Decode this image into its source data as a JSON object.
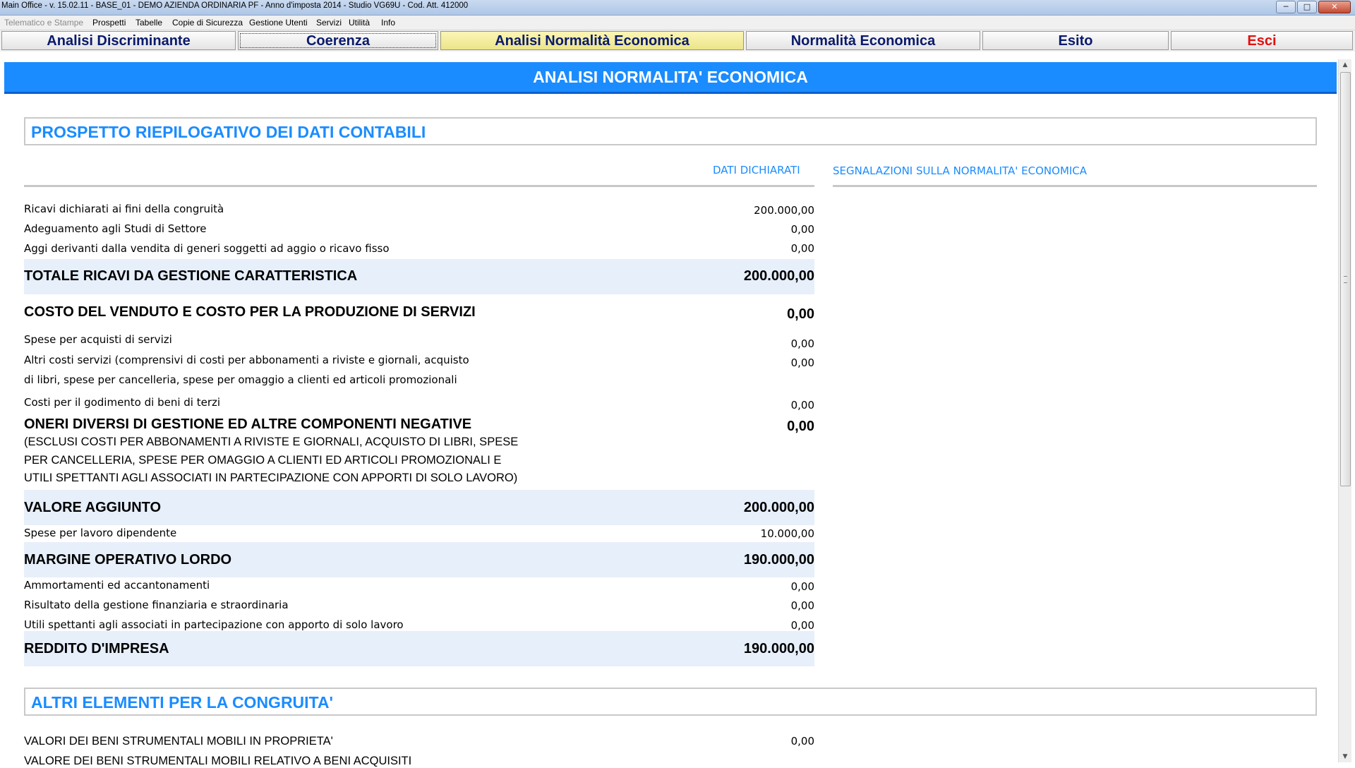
{
  "window": {
    "title": "Main Office - v. 15.02.11 - BASE_01 - DEMO AZIENDA ORDINARIA PF - Anno d'imposta 2014 - Studio VG69U - Cod. Att. 412000",
    "min": "─",
    "max": "□",
    "close": "✕"
  },
  "menu": {
    "telematico": "Telematico e Stampe",
    "prospetti": "Prospetti",
    "tabelle": "Tabelle",
    "copie": "Copie di Sicurezza",
    "utenti": "Gestione Utenti",
    "servizi": "Servizi",
    "utilita": "Utilità",
    "info": "Info"
  },
  "tabs": {
    "discriminante": "Analisi Discriminante",
    "coerenza": "Coerenza",
    "normalita_analisi": "Analisi Normalità Economica",
    "normalita": "Normalità Economica",
    "esito": "Esito",
    "esci": "Esci"
  },
  "page": {
    "banner": "ANALISI NORMALITA' ECONOMICA",
    "section1": "PROSPETTO RIEPILOGATIVO DEI DATI CONTABILI",
    "col_dati": "DATI DICHIARATI",
    "col_segnalazioni": "SEGNALAZIONI SULLA NORMALITA' ECONOMICA",
    "section2": "ALTRI ELEMENTI PER LA CONGRUITA'"
  },
  "rows": {
    "ricavi_label": "Ricavi dichiarati ai fini della congruità",
    "ricavi_value": "200.000,00",
    "adeguamento_label": "Adeguamento agli Studi di Settore",
    "adeguamento_value": "0,00",
    "aggi_label": "Aggi derivanti dalla vendita di generi soggetti ad aggio o ricavo fisso",
    "aggi_value": "0,00",
    "totale_label": "TOTALE RICAVI DA GESTIONE CARATTERISTICA",
    "totale_value": "200.000,00",
    "costo_label": "COSTO DEL VENDUTO E COSTO PER LA PRODUZIONE DI SERVIZI",
    "costo_value": "0,00",
    "spese_servizi_label": "Spese per acquisti di servizi",
    "spese_servizi_value": "0,00",
    "altri_costi_label1": "Altri costi servizi (comprensivi di costi per abbonamenti a riviste e giornali, acquisto",
    "altri_costi_label2": "di libri, spese per cancelleria, spese per omaggio a clienti ed articoli promozionali",
    "altri_costi_value": "0,00",
    "godimento_label": "Costi per il godimento di beni di terzi",
    "godimento_value": "0,00",
    "oneri_label": "ONERI DIVERSI DI GESTIONE ED ALTRE COMPONENTI NEGATIVE",
    "oneri_value": "0,00",
    "oneri_note1": "(ESCLUSI COSTI PER ABBONAMENTI A RIVISTE E GIORNALI, ACQUISTO DI LIBRI, SPESE",
    "oneri_note2": "PER CANCELLERIA, SPESE PER OMAGGIO A CLIENTI ED ARTICOLI PROMOZIONALI E",
    "oneri_note3": "UTILI SPETTANTI AGLI ASSOCIATI IN PARTECIPAZIONE CON APPORTI DI SOLO LAVORO)",
    "valore_aggiunto_label": "VALORE AGGIUNTO",
    "valore_aggiunto_value": "200.000,00",
    "lavoro_label": "Spese per lavoro dipendente",
    "lavoro_value": "10.000,00",
    "mol_label": "MARGINE OPERATIVO LORDO",
    "mol_value": "190.000,00",
    "ammortamenti_label": "Ammortamenti ed accantonamenti",
    "ammortamenti_value": "0,00",
    "finanziaria_label": "Risultato della gestione finanziaria e straordinaria",
    "finanziaria_value": "0,00",
    "utili_label": "Utili spettanti agli associati in partecipazione con apporto di solo lavoro",
    "utili_value": "0,00",
    "reddito_label": "REDDITO D'IMPRESA",
    "reddito_value": "190.000,00",
    "beni_label": "VALORI DEI BENI STRUMENTALI MOBILI IN PROPRIETA'",
    "beni_value": "0,00",
    "beni_acq_label": "VALORE DEI BENI STRUMENTALI MOBILI RELATIVO A BENI ACQUISITI"
  },
  "scrollbar": {
    "up": "▲",
    "down": "▼"
  }
}
